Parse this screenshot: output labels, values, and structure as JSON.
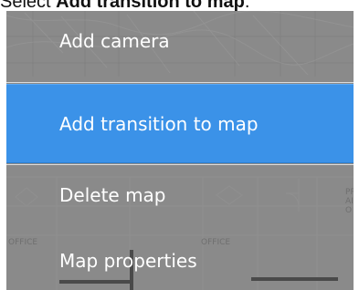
{
  "instruction": {
    "prefix": "Select ",
    "bold_text": "Add transition to map",
    "suffix": "."
  },
  "context_menu": {
    "items": [
      {
        "label": "Add camera",
        "active": false
      },
      {
        "label": "Add transition to map",
        "active": true
      },
      {
        "label": "Delete map",
        "active": false
      },
      {
        "label": "Map properties",
        "active": false
      }
    ]
  },
  "map_labels": {
    "office_left": "OFFICE",
    "office_right": "OFFICE",
    "right_text_1": "PR",
    "right_text_2": "AI",
    "right_text_3": "O"
  },
  "colors": {
    "highlight": "#3b92e8",
    "menu_background": "#8c8c8c",
    "text": "#ffffff"
  }
}
